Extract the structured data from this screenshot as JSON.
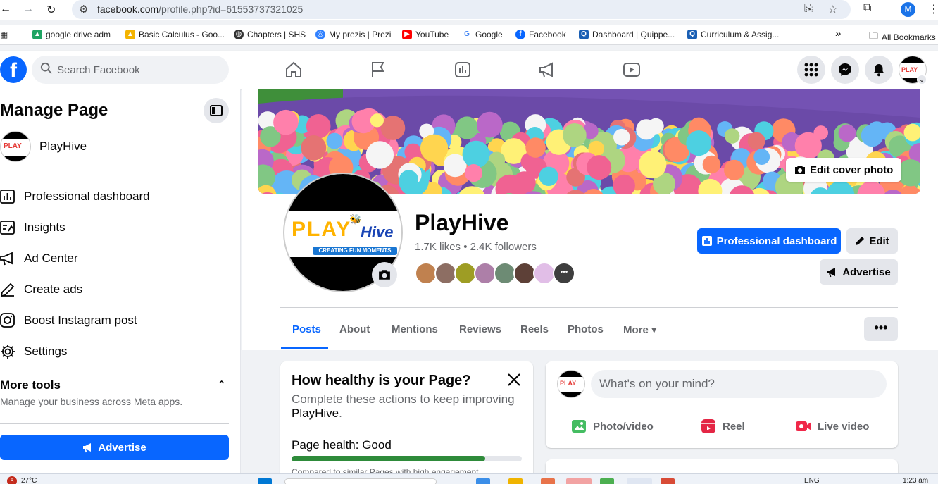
{
  "browser": {
    "url_host": "facebook.com",
    "url_path": "/profile.php?id=61553737321025",
    "profile_initial": "M",
    "bookmarks": [
      {
        "label": "google drive adm",
        "icon": "google-drive-icon",
        "color": "#1fa463"
      },
      {
        "label": "Basic Calculus - Goo...",
        "icon": "google-drive-icon",
        "color": "#f4b400"
      },
      {
        "label": "Chapters | SHS",
        "icon": "globe-icon",
        "color": "#333333"
      },
      {
        "label": "My prezis | Prezi",
        "icon": "prezi-icon",
        "color": "#3181ff"
      },
      {
        "label": "YouTube",
        "icon": "youtube-icon",
        "color": "#ff0000"
      },
      {
        "label": "Google",
        "icon": "google-icon",
        "color": "#4285f4"
      },
      {
        "label": "Facebook",
        "icon": "facebook-icon",
        "color": "#0866ff"
      },
      {
        "label": "Dashboard | Quippe...",
        "icon": "quipper-icon",
        "color": "#1a5fb4"
      },
      {
        "label": "Curriculum & Assig...",
        "icon": "quipper-icon",
        "color": "#1a5fb4"
      }
    ],
    "bookmarks_overflow": "»",
    "all_bookmarks": "All Bookmarks"
  },
  "fb": {
    "logo": "f",
    "search_placeholder": "Search Facebook",
    "brand_color": "#0866ff"
  },
  "manage": {
    "title": "Manage Page",
    "page_name": "PlayHive",
    "items": [
      {
        "label": "Professional dashboard",
        "icon": "dashboard-icon"
      },
      {
        "label": "Insights",
        "icon": "insights-icon"
      },
      {
        "label": "Ad Center",
        "icon": "megaphone-icon"
      },
      {
        "label": "Create ads",
        "icon": "pencil-icon"
      },
      {
        "label": "Boost Instagram post",
        "icon": "instagram-icon"
      },
      {
        "label": "Settings",
        "icon": "gear-icon"
      }
    ],
    "more_tools": "More tools",
    "more_tools_sub": "Manage your business across Meta apps.",
    "advertise": "Advertise"
  },
  "profile": {
    "edit_cover": "Edit cover photo",
    "name": "PlayHive",
    "stats": "1.7K likes • 2.4K followers",
    "logo_word_play": "PLAY",
    "logo_word_hive": "Hive",
    "logo_tagline": "CREATING FUN MOMENTS",
    "friend_colors": [
      "#c0814f",
      "#8d6e63",
      "#9e9d24",
      "#ad7fa8",
      "#6d8b74",
      "#5d4037",
      "#e1bee7",
      "#3e3e3e"
    ],
    "btn_dashboard": "Professional dashboard",
    "btn_edit": "Edit",
    "btn_advertise": "Advertise",
    "tabs": [
      "Posts",
      "About",
      "Mentions",
      "Reviews",
      "Reels",
      "Photos",
      "More ▾"
    ],
    "more_dots": "•••"
  },
  "health": {
    "title": "How healthy is your Page?",
    "desc_prefix": "Complete these actions to keep improving",
    "desc_page": "PlayHive",
    "desc_suffix": ".",
    "status": "Page health: Good",
    "progress": 0.84,
    "subtext": "Compared to similar Pages with high engagement"
  },
  "compose": {
    "placeholder": "What's on your mind?",
    "actions": [
      {
        "label": "Photo/video",
        "icon": "photo-icon",
        "color": "#45bd62"
      },
      {
        "label": "Reel",
        "icon": "reel-icon",
        "color": "#e42645"
      },
      {
        "label": "Live video",
        "icon": "live-video-icon",
        "color": "#f02849"
      }
    ]
  },
  "taskbar": {
    "badge": "5",
    "weather": "27°C",
    "lang": "ENG",
    "time": "1:23 am"
  }
}
